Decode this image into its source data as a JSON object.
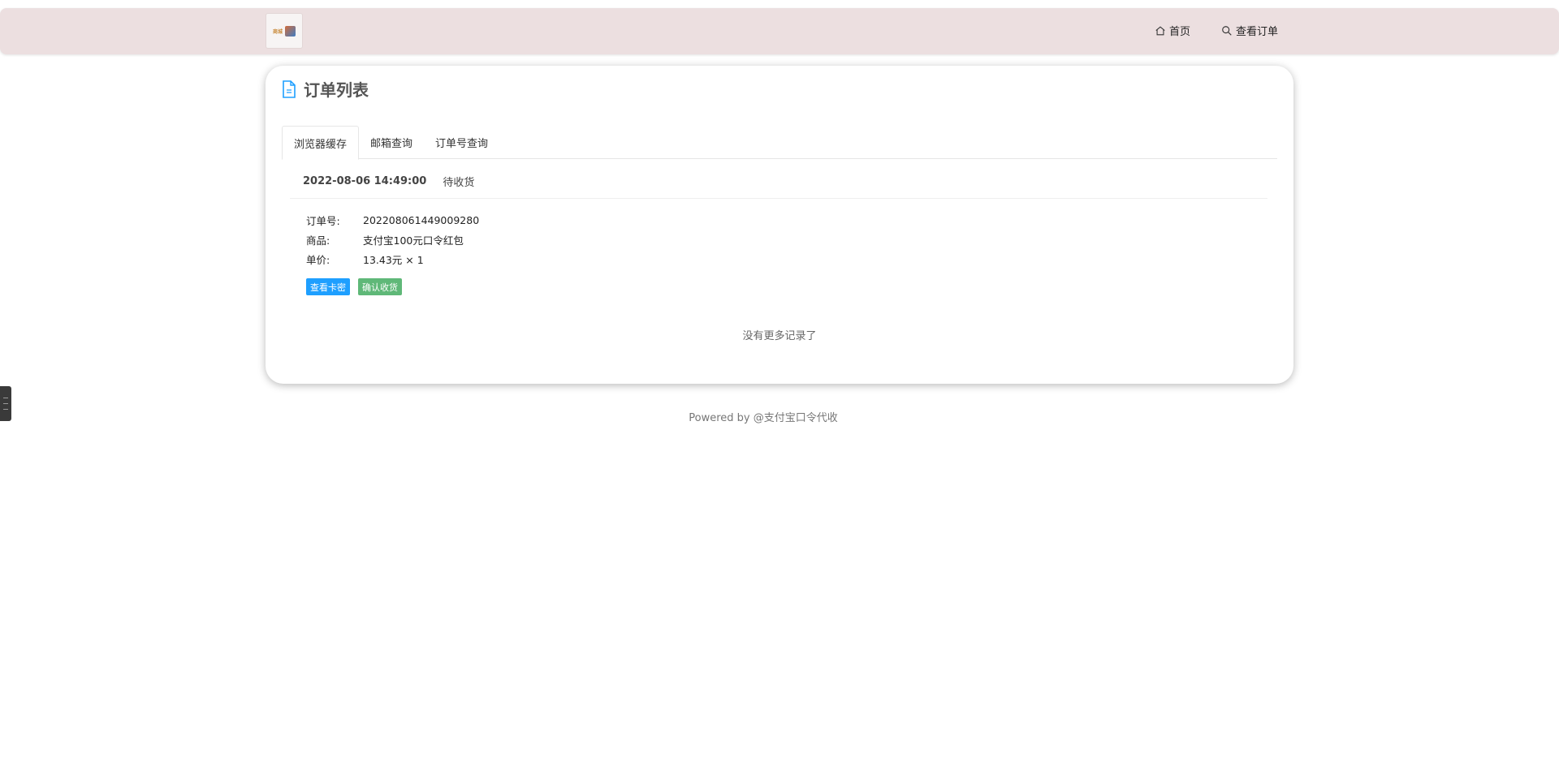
{
  "nav": {
    "logo_text": "商城",
    "links": [
      {
        "label": "首页",
        "icon": "home-icon"
      },
      {
        "label": "查看订单",
        "icon": "search-icon"
      }
    ]
  },
  "card": {
    "title": "订单列表",
    "tabs": [
      {
        "label": "浏览器缓存",
        "active": true
      },
      {
        "label": "邮箱查询",
        "active": false
      },
      {
        "label": "订单号查询",
        "active": false
      }
    ]
  },
  "order": {
    "time": "2022-08-06 14:49:00",
    "status": "待收货",
    "fields": [
      {
        "key": "订单号:",
        "value": "202208061449009280"
      },
      {
        "key": "商品:",
        "value": "支付宝100元口令红包"
      },
      {
        "key": "单价:",
        "value": "13.43元 × 1"
      }
    ],
    "view_button": "查看卡密",
    "confirm_button": "确认收货"
  },
  "no_more": "没有更多记录了",
  "footer": "Powered by @支付宝口令代收",
  "colors": {
    "accent_blue": "#1e9fff",
    "accent_green": "#5fb878",
    "navbar_bg": "#ecdfe0"
  }
}
